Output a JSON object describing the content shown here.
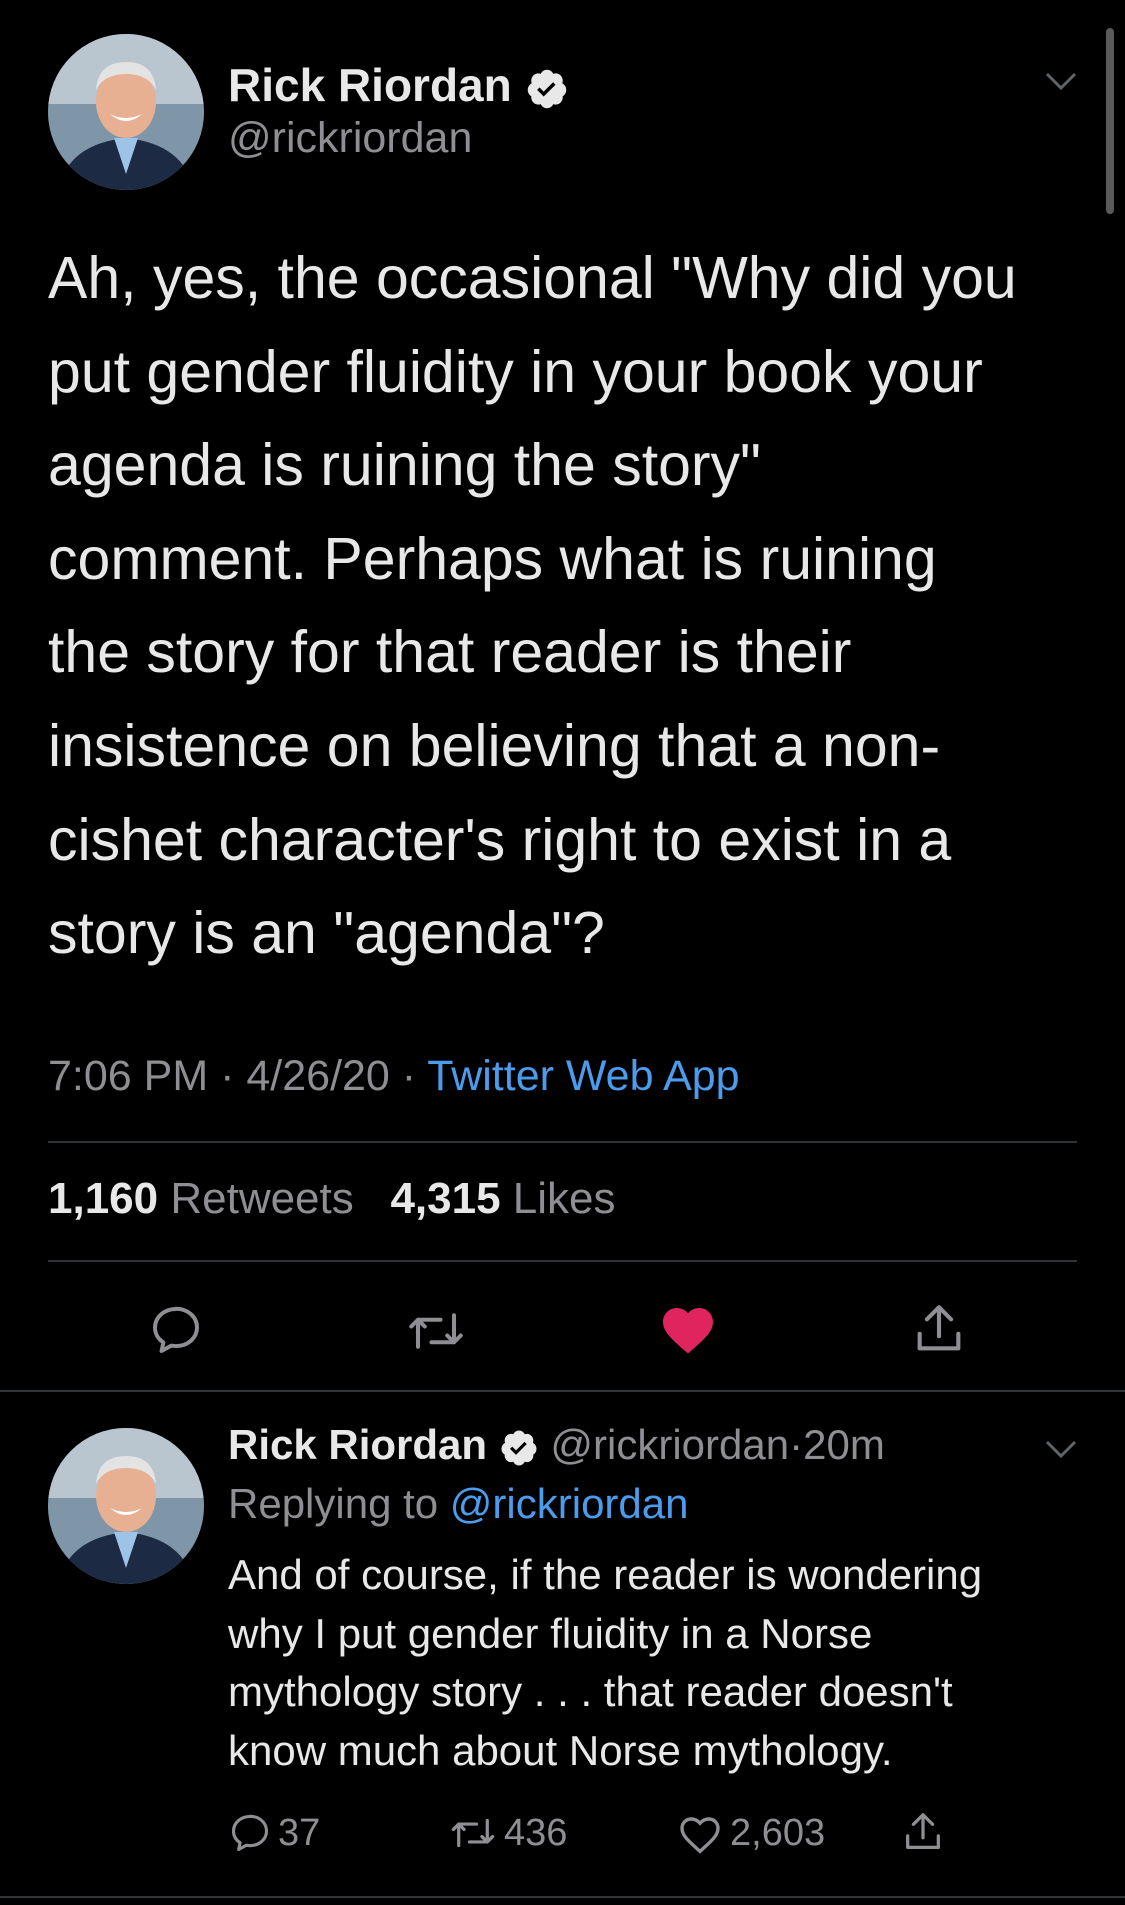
{
  "tweet": {
    "author_name": "Rick Riordan",
    "handle": "@rickriordan",
    "text_lines": [
      "Ah, yes, the occasional \"Why did you",
      "put gender fluidity in your book your",
      "agenda is ruining the story\"",
      "comment. Perhaps what is ruining",
      "the story for that reader is their",
      "insistence on believing that a non-",
      "cishet character's right to exist in a",
      "story is an \"agenda\"?"
    ],
    "time": "7:06 PM",
    "date": "4/26/20",
    "separator": "·",
    "source": "Twitter Web App",
    "retweets_count": "1,160",
    "retweets_label": "Retweets",
    "likes_count": "4,315",
    "likes_label": "Likes",
    "liked": true
  },
  "reply": {
    "author_name": "Rick Riordan",
    "handle": "@rickriordan",
    "separator": "·",
    "age": "20m",
    "replying_to_label": "Replying to",
    "replying_to_handle": "@rickriordan",
    "text_lines": [
      "And of course, if the reader is wondering",
      "why I put gender fluidity in a Norse",
      "mythology story . . . that reader doesn't",
      "know much about Norse mythology."
    ],
    "reply_count": "37",
    "retweet_count": "436",
    "like_count": "2,603"
  },
  "colors": {
    "background": "#000000",
    "text_primary": "#e8e8e8",
    "text_secondary": "#8e8e93",
    "link": "#4b9cec",
    "like_active": "#e0245e",
    "divider": "#2f3336"
  },
  "icons": [
    "chevron-down-icon",
    "verified-badge-icon",
    "reply-icon",
    "retweet-icon",
    "heart-icon",
    "share-icon"
  ]
}
